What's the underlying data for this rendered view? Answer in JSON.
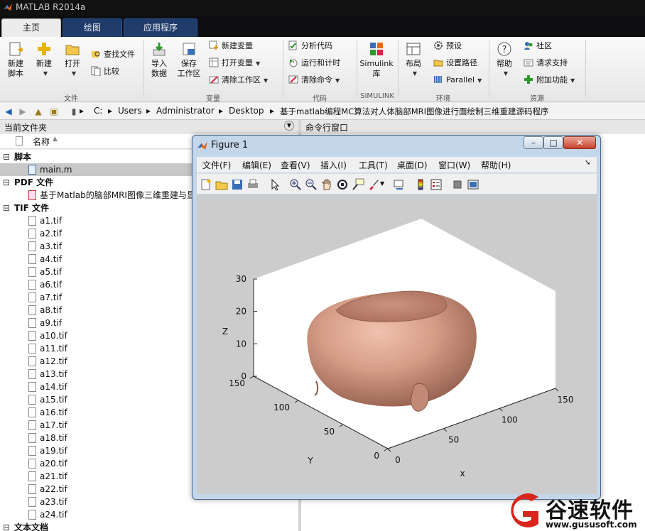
{
  "window": {
    "title": "MATLAB R2014a"
  },
  "tabs": [
    {
      "label": "主页",
      "active": true
    },
    {
      "label": "绘图",
      "active": false
    },
    {
      "label": "应用程序",
      "active": false
    }
  ],
  "ribbon": {
    "file": {
      "new_script": "新建\n脚本",
      "new": "新建",
      "open": "打开",
      "find_files": "查找文件",
      "compare": "比较",
      "group": "文件"
    },
    "variable": {
      "import": "导入\n数据",
      "save_ws": "保存\n工作区",
      "new_var": "新建变量",
      "open_var": "打开变量",
      "clear_ws": "清除工作区",
      "group": "变量"
    },
    "code": {
      "analyze": "分析代码",
      "run_time": "运行和计时",
      "clear_cmd": "清除命令",
      "group": "代码"
    },
    "simulink": {
      "lib": "Simulink\n库",
      "group": "SIMULINK"
    },
    "env": {
      "layout": "布局",
      "prefs": "预设",
      "set_path": "设置路径",
      "parallel": "Parallel",
      "group": "环境"
    },
    "resources": {
      "help": "帮助",
      "community": "社区",
      "support": "请求支持",
      "addons": "附加功能",
      "group": "资源"
    }
  },
  "address": {
    "crumbs": [
      "C:",
      "Users",
      "Administrator",
      "Desktop",
      "基于matlab编程MC算法对人体脑部MRI图像进行面绘制三维重建源码程序"
    ]
  },
  "current_folder": {
    "title": "当前文件夹",
    "col_name": "名称",
    "groups": [
      {
        "label": "脚本",
        "files": [
          "main.m"
        ]
      },
      {
        "label": "PDF 文件",
        "files": [
          "基于Matlab的脑部MRI图像三维重建与显"
        ]
      },
      {
        "label": "TIF 文件",
        "files": [
          "a1.tif",
          "a2.tif",
          "a3.tif",
          "a4.tif",
          "a5.tif",
          "a6.tif",
          "a7.tif",
          "a8.tif",
          "a9.tif",
          "a10.tif",
          "a11.tif",
          "a12.tif",
          "a13.tif",
          "a14.tif",
          "a15.tif",
          "a16.tif",
          "a17.tif",
          "a18.tif",
          "a19.tif",
          "a20.tif",
          "a21.tif",
          "a22.tif",
          "a23.tif",
          "a24.tif"
        ]
      },
      {
        "label": "文本文档",
        "files": []
      }
    ],
    "selected": "main.m"
  },
  "command_window": {
    "title": "命令行窗口"
  },
  "figure": {
    "title": "Figure 1",
    "menus": [
      "文件(F)",
      "编辑(E)",
      "查看(V)",
      "插入(I)",
      "工具(T)",
      "桌面(D)",
      "窗口(W)",
      "帮助(H)"
    ],
    "plot": {
      "z_ticks": [
        "0",
        "10",
        "20",
        "30"
      ],
      "y_ticks": [
        "0",
        "50",
        "100",
        "150"
      ],
      "x_ticks": [
        "0",
        "50",
        "100",
        "150"
      ],
      "xlabel": "x",
      "ylabel": "Y",
      "zlabel": "Z",
      "surface_color": "#c9907c"
    }
  },
  "watermark": {
    "brand": "谷速软件",
    "url": "www.gususoft.com"
  }
}
